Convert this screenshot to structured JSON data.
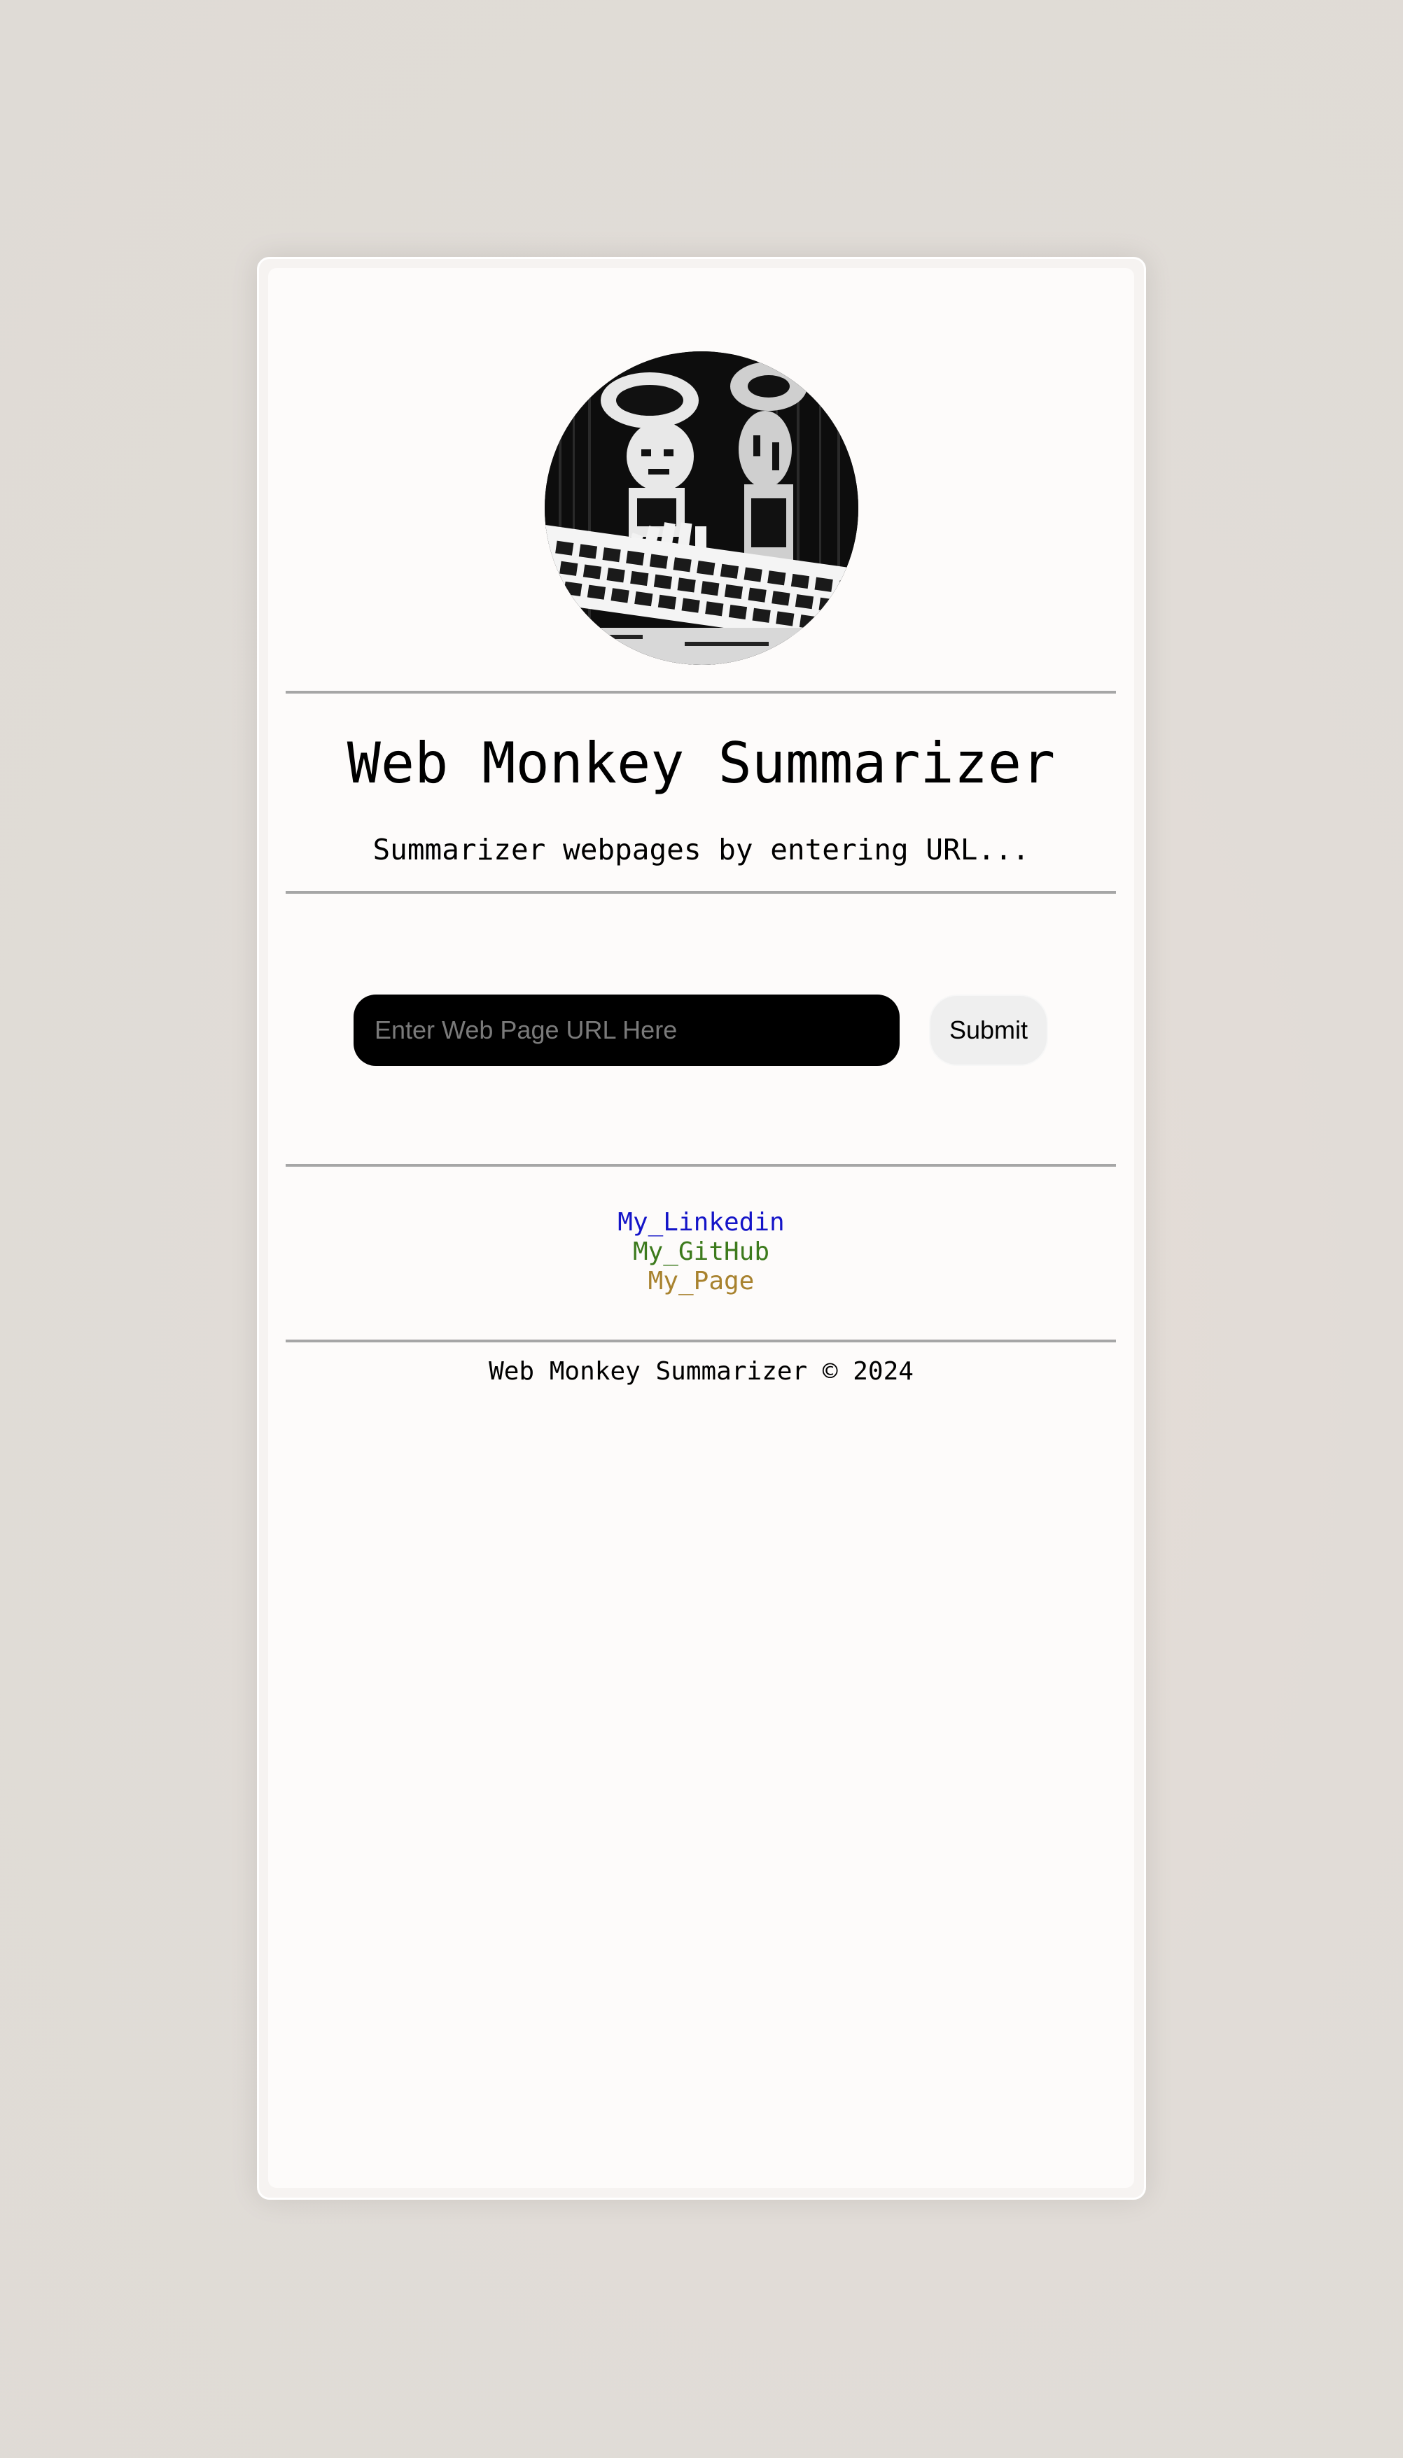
{
  "header": {
    "avatar_alt": "monkey-at-keyboard",
    "title": "Web Monkey Summarizer",
    "subtitle": "Summarizer webpages by entering URL..."
  },
  "form": {
    "url_placeholder": "Enter Web Page URL Here",
    "url_value": "",
    "submit_label": "Submit"
  },
  "links": [
    {
      "label": "My_Linkedin",
      "color": "#1414c8"
    },
    {
      "label": "My_GitHub",
      "color": "#3c7a1c"
    },
    {
      "label": "My_Page",
      "color": "#a8822e"
    }
  ],
  "footer": {
    "text": "Web Monkey Summarizer © 2024"
  },
  "colors": {
    "background": "#e1dcd7",
    "card": "#fdfbfa",
    "input_bg": "#000000",
    "button_bg": "#efefef",
    "rule": "#a6a6a6"
  }
}
